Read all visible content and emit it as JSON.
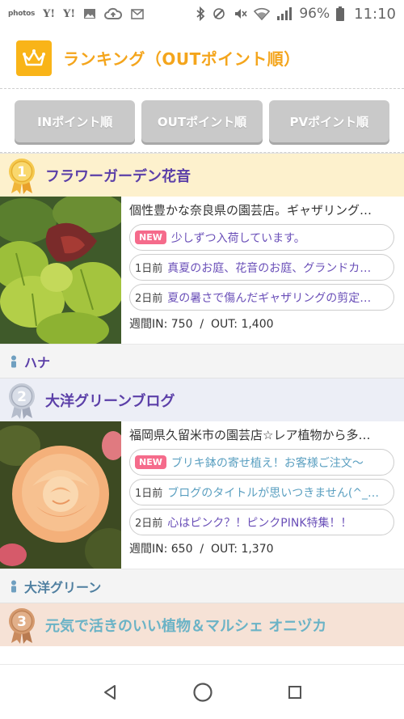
{
  "status_bar": {
    "photos": "photos",
    "yahoo1": "Y!",
    "yahoo2": "Y!",
    "battery": "96%",
    "time": "11:10"
  },
  "header": {
    "title": "ランキング（OUTポイント順）"
  },
  "sort_buttons": [
    "INポイント順",
    "OUTポイント順",
    "PVポイント順"
  ],
  "entries": [
    {
      "rank": "1",
      "title": "フラワーガーデン花音",
      "description": "個性豊かな奈良県の園芸店。ギャザリング…",
      "posts": [
        {
          "badge": "NEW",
          "day": "",
          "text": "少しずつ入荷しています。"
        },
        {
          "badge": "",
          "day": "1日前",
          "text": "真夏のお庭、花音のお庭、グランドカ…"
        },
        {
          "badge": "",
          "day": "2日前",
          "text": "夏の暑さで傷んだギャザリングの剪定…"
        }
      ],
      "stats": "週間IN: 750  /  OUT: 1,400",
      "author": "ハナ"
    },
    {
      "rank": "2",
      "title": "大洋グリーンブログ",
      "description": "福岡県久留米市の園芸店☆レア植物から多…",
      "posts": [
        {
          "badge": "NEW",
          "day": "",
          "text": "ブリキ鉢の寄せ植え！お客様ご注文～"
        },
        {
          "badge": "",
          "day": "1日前",
          "text": "ブログのタイトルが思いつきません(^_…"
        },
        {
          "badge": "",
          "day": "2日前",
          "text": "心はピンク？！ピンクPINK特集！！"
        }
      ],
      "stats": "週間IN: 650  /  OUT: 1,370",
      "author": "大洋グリーン"
    },
    {
      "rank": "3",
      "title": "元気で活きのいい植物＆マルシェ オニヅカ"
    }
  ],
  "colors": {
    "accent": "#f4a51c",
    "title_purple": "#5b3fa8",
    "new_badge": "#f56b8b",
    "gold_bg": "#fdf1cd",
    "silver_bg": "#eceef6",
    "bronze_bg": "#f6e2d6"
  },
  "icons": [
    "crown-icon",
    "person-icon",
    "medal-gold-icon",
    "medal-silver-icon",
    "medal-bronze-icon",
    "back-icon",
    "home-icon",
    "recents-icon"
  ]
}
